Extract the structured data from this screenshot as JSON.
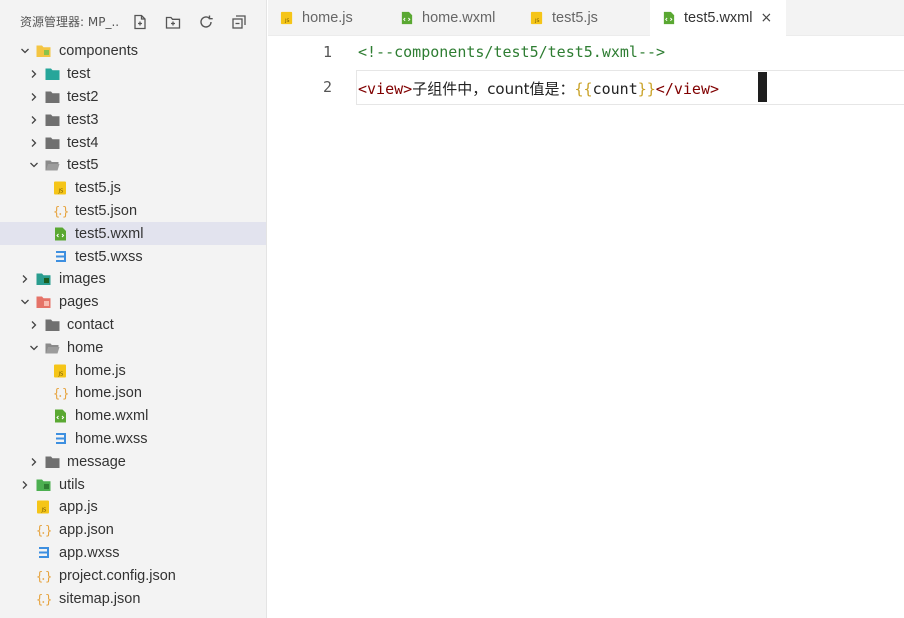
{
  "sidebar": {
    "title": "资源管理器: MP_...",
    "actions": [
      "new-file-icon",
      "new-folder-icon",
      "refresh-icon",
      "collapse-all-icon"
    ]
  },
  "tree": [
    {
      "label": "components",
      "depth": 0,
      "type": "folder-components",
      "expanded": true
    },
    {
      "label": "test",
      "depth": 1,
      "type": "folder-teal",
      "expanded": false
    },
    {
      "label": "test2",
      "depth": 1,
      "type": "folder",
      "expanded": false
    },
    {
      "label": "test3",
      "depth": 1,
      "type": "folder",
      "expanded": false
    },
    {
      "label": "test4",
      "depth": 1,
      "type": "folder",
      "expanded": false
    },
    {
      "label": "test5",
      "depth": 1,
      "type": "folder-open",
      "expanded": true
    },
    {
      "label": "test5.js",
      "depth": 2,
      "type": "js"
    },
    {
      "label": "test5.json",
      "depth": 2,
      "type": "json"
    },
    {
      "label": "test5.wxml",
      "depth": 2,
      "type": "wxml",
      "selected": true
    },
    {
      "label": "test5.wxss",
      "depth": 2,
      "type": "wxss"
    },
    {
      "label": "images",
      "depth": 0,
      "type": "folder-images",
      "expanded": false
    },
    {
      "label": "pages",
      "depth": 0,
      "type": "folder-pages",
      "expanded": true
    },
    {
      "label": "contact",
      "depth": 1,
      "type": "folder",
      "expanded": false
    },
    {
      "label": "home",
      "depth": 1,
      "type": "folder-open",
      "expanded": true
    },
    {
      "label": "home.js",
      "depth": 2,
      "type": "js"
    },
    {
      "label": "home.json",
      "depth": 2,
      "type": "json"
    },
    {
      "label": "home.wxml",
      "depth": 2,
      "type": "wxml"
    },
    {
      "label": "home.wxss",
      "depth": 2,
      "type": "wxss"
    },
    {
      "label": "message",
      "depth": 1,
      "type": "folder",
      "expanded": false
    },
    {
      "label": "utils",
      "depth": 0,
      "type": "folder-utils",
      "expanded": false
    },
    {
      "label": "app.js",
      "depth": 0,
      "type": "js",
      "file": true
    },
    {
      "label": "app.json",
      "depth": 0,
      "type": "json",
      "file": true
    },
    {
      "label": "app.wxss",
      "depth": 0,
      "type": "wxss",
      "file": true
    },
    {
      "label": "project.config.json",
      "depth": 0,
      "type": "json",
      "file": true
    },
    {
      "label": "sitemap.json",
      "depth": 0,
      "type": "json",
      "file": true
    }
  ],
  "tabs": [
    {
      "label": "home.js",
      "icon": "js-file-icon",
      "active": false
    },
    {
      "label": "home.wxml",
      "icon": "wxml-file-icon",
      "active": false
    },
    {
      "label": "test5.js",
      "icon": "js-file-icon",
      "active": false
    },
    {
      "label": "test5.wxml",
      "icon": "wxml-file-icon",
      "active": true,
      "close": "×"
    }
  ],
  "editor": {
    "line_numbers": [
      "1",
      "2"
    ],
    "line1": "<!--components/test5/test5.wxml-->",
    "line2": {
      "open_tag": "<view>",
      "text": "子组件中，count值是：",
      "brace_open": "{{",
      "var": "count",
      "brace_close": "}}",
      "close_tag": "</view>"
    }
  },
  "colors": {
    "js": "#f5c518",
    "json": "#e6a23c",
    "wxml": "#5aa832",
    "wxss": "#3d8fe0",
    "folder": "#707070",
    "comment": "#2e7d32",
    "tag": "#800000",
    "brace": "#c9a227"
  }
}
